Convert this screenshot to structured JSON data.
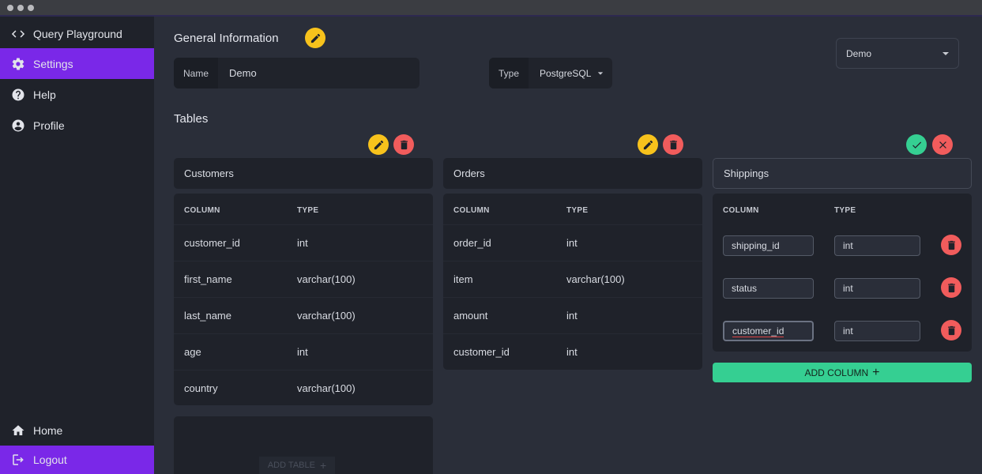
{
  "sidebar": {
    "items": [
      {
        "label": "Query Playground",
        "icon": "code-icon"
      },
      {
        "label": "Settings",
        "icon": "gear-icon"
      },
      {
        "label": "Help",
        "icon": "help-icon"
      },
      {
        "label": "Profile",
        "icon": "profile-icon"
      }
    ],
    "bottom": [
      {
        "label": "Home",
        "icon": "home-icon"
      },
      {
        "label": "Logout",
        "icon": "logout-icon"
      }
    ],
    "active": "Settings",
    "accent": "#7a28e8"
  },
  "general": {
    "title": "General Information",
    "name_label": "Name",
    "name_value": "Demo",
    "type_label": "Type",
    "type_value": "PostgreSQL",
    "db_select": "Demo"
  },
  "tables_title": "Tables",
  "tables": [
    {
      "name": "Customers",
      "headers": [
        "COLUMN",
        "TYPE"
      ],
      "rows": [
        [
          "customer_id",
          "int"
        ],
        [
          "first_name",
          "varchar(100)"
        ],
        [
          "last_name",
          "varchar(100)"
        ],
        [
          "age",
          "int"
        ],
        [
          "country",
          "varchar(100)"
        ]
      ]
    },
    {
      "name": "Orders",
      "headers": [
        "COLUMN",
        "TYPE"
      ],
      "rows": [
        [
          "order_id",
          "int"
        ],
        [
          "item",
          "varchar(100)"
        ],
        [
          "amount",
          "int"
        ],
        [
          "customer_id",
          "int"
        ]
      ]
    },
    {
      "name": "Shippings",
      "editing": true,
      "headers": [
        "COLUMN",
        "TYPE"
      ],
      "rows": [
        [
          "shipping_id",
          "int"
        ],
        [
          "status",
          "int"
        ],
        [
          "customer_id",
          "int"
        ]
      ]
    }
  ],
  "add_column_label": "ADD COLUMN",
  "add_table_label": "ADD TABLE",
  "colors": {
    "edit": "#f7c21c",
    "delete": "#f15c5c",
    "confirm": "#35cf92"
  }
}
